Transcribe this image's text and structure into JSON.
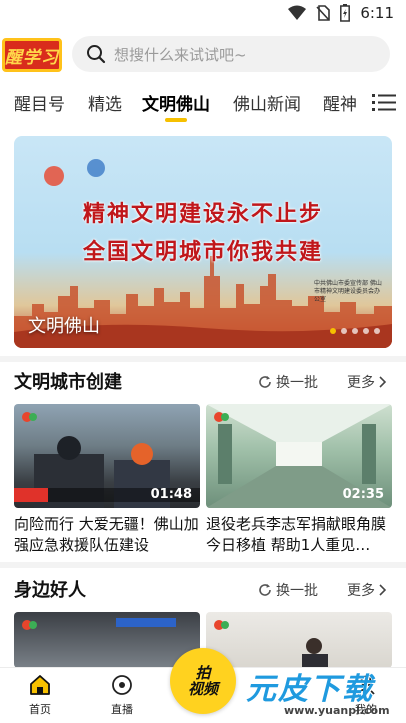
{
  "status_bar": {
    "time": "6:11"
  },
  "header": {
    "logo_text": "醒学习",
    "search_placeholder": "想搜什么来试试吧~"
  },
  "tabs": [
    {
      "label": "醒目号",
      "active": false
    },
    {
      "label": "精选",
      "active": false
    },
    {
      "label": "文明佛山",
      "active": true
    },
    {
      "label": "佛山新闻",
      "active": false
    },
    {
      "label": "醒神",
      "active": false
    }
  ],
  "banner": {
    "line1": "精神文明建设永不止步",
    "line2": "全国文明城市你我共建",
    "caption": "文明佛山",
    "org_text": "中共佛山市委宣传部 佛山市精神文明建设委员会办公室"
  },
  "section1": {
    "title": "文明城市创建",
    "swap_label": "换一批",
    "more_label": "更多",
    "videos": [
      {
        "title": "向险而行 大爱无疆！佛山加强应急救援队伍建设",
        "duration": "01:48"
      },
      {
        "title": "退役老兵李志军捐献眼角膜今日移植 帮助1人重见…",
        "duration": "02:35"
      }
    ]
  },
  "section2": {
    "title": "身边好人",
    "swap_label": "换一批",
    "more_label": "更多"
  },
  "bottom_nav": {
    "home": "首页",
    "live": "直播",
    "shoot_line1": "拍",
    "shoot_line2": "视频",
    "me": "我的"
  },
  "watermark": {
    "title": "元皮下载",
    "url": "www.yuanpi.com"
  },
  "colors": {
    "accent": "#f6c000",
    "banner_text": "#c0171b",
    "brand_red": "#d92c1c"
  }
}
